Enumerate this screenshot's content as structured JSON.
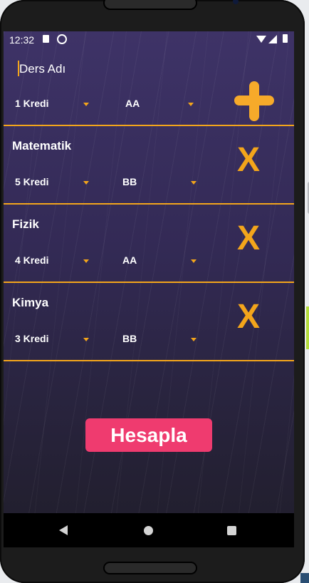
{
  "statusbar": {
    "time": "12:32"
  },
  "new_course": {
    "placeholder": "Ders Adı",
    "credit": "1 Kredi",
    "grade": "AA"
  },
  "courses": [
    {
      "name": "Matematik",
      "credit": "5 Kredi",
      "grade": "BB"
    },
    {
      "name": "Fizik",
      "credit": "4 Kredi",
      "grade": "AA"
    },
    {
      "name": "Kimya",
      "credit": "3 Kredi",
      "grade": "BB"
    }
  ],
  "remove_symbol": "X",
  "calculate_label": "Hesapla",
  "colors": {
    "accent": "#f3a51b",
    "button": "#ef3b6f",
    "background": "#3e3367"
  },
  "icons": [
    "sim-icon",
    "sync-icon",
    "wifi-icon",
    "signal-icon",
    "battery-icon",
    "add-icon",
    "back-icon",
    "home-icon",
    "recents-icon"
  ]
}
